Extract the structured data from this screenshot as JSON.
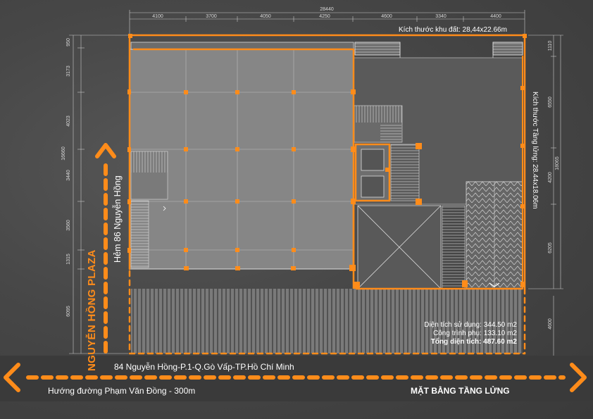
{
  "site_size_label": "Kích thước khu đất: 28,44x22.66m",
  "mezzanine_size_label": "Kích thước Tầng lửng: 28.44x18.06m",
  "overall_width": "28440",
  "top_dimensions": [
    "4100",
    "3700",
    "4050",
    "4250",
    "4600",
    "3340",
    "4400"
  ],
  "left_dimensions": [
    "950",
    "3173",
    "4023",
    "16660",
    "3440",
    "3560",
    "1315",
    "6095"
  ],
  "right_dimensions": [
    "1110",
    "6550",
    "4200",
    "18065",
    "6205",
    "4600"
  ],
  "side_street": "Hẻm 86 Nguyễn Hồng",
  "building_name": "NGUYỄN HỒNG PLAZA",
  "address": "84 Nguyễn Hồng-P.1-Q.Gò Vấp-TP.Hồ Chí Minh",
  "direction": "Hướng đường Phạm Văn Đồng - 300m",
  "plan_title": "MẶT BẰNG TẦNG LỬNG",
  "area": {
    "used": "Diện tích sử dụng: 344.50 m2",
    "auxiliary": "Công trình phụ: 133.10 m2",
    "total": "Tổng diện tích: 487.60 m2"
  },
  "colors": {
    "accent": "#ff8c1a",
    "background": "#4a4a4a",
    "line": "#dcdcdc",
    "text": "#ffffff"
  }
}
